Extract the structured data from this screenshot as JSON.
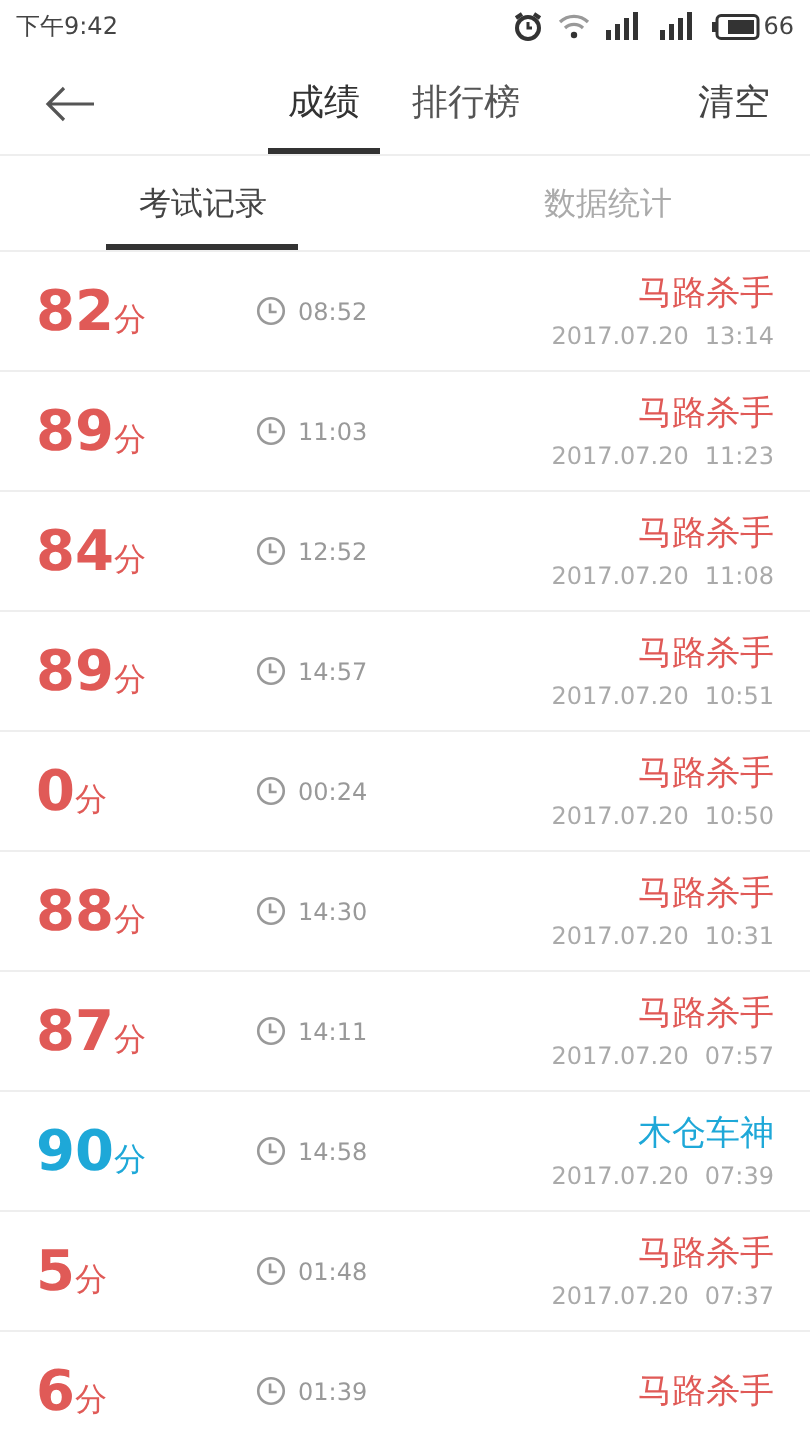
{
  "status_bar": {
    "time": "下午9:42",
    "battery": "66"
  },
  "header": {
    "tabs": [
      {
        "label": "成绩",
        "selected": true
      },
      {
        "label": "排行榜",
        "selected": false
      }
    ],
    "action": "清空"
  },
  "sub_tabs": [
    {
      "label": "考试记录",
      "selected": true
    },
    {
      "label": "数据统计",
      "selected": false
    }
  ],
  "records": [
    {
      "score": "82",
      "unit": "分",
      "duration": "08:52",
      "title": "马路杀手",
      "date": "2017.07.20",
      "time": "13:14",
      "color": "#e05a57"
    },
    {
      "score": "89",
      "unit": "分",
      "duration": "11:03",
      "title": "马路杀手",
      "date": "2017.07.20",
      "time": "11:23",
      "color": "#e05a57"
    },
    {
      "score": "84",
      "unit": "分",
      "duration": "12:52",
      "title": "马路杀手",
      "date": "2017.07.20",
      "time": "11:08",
      "color": "#e05a57"
    },
    {
      "score": "89",
      "unit": "分",
      "duration": "14:57",
      "title": "马路杀手",
      "date": "2017.07.20",
      "time": "10:51",
      "color": "#e05a57"
    },
    {
      "score": "0",
      "unit": "分",
      "duration": "00:24",
      "title": "马路杀手",
      "date": "2017.07.20",
      "time": "10:50",
      "color": "#e05a57"
    },
    {
      "score": "88",
      "unit": "分",
      "duration": "14:30",
      "title": "马路杀手",
      "date": "2017.07.20",
      "time": "10:31",
      "color": "#e05a57"
    },
    {
      "score": "87",
      "unit": "分",
      "duration": "14:11",
      "title": "马路杀手",
      "date": "2017.07.20",
      "time": "07:57",
      "color": "#e05a57"
    },
    {
      "score": "90",
      "unit": "分",
      "duration": "14:58",
      "title": "木仓车神",
      "date": "2017.07.20",
      "time": "07:39",
      "color": "#1ea8d8"
    },
    {
      "score": "5",
      "unit": "分",
      "duration": "01:48",
      "title": "马路杀手",
      "date": "2017.07.20",
      "time": "07:37",
      "color": "#e05a57"
    },
    {
      "score": "6",
      "unit": "分",
      "duration": "01:39",
      "title": "马路杀手",
      "color": "#e05a57"
    }
  ]
}
